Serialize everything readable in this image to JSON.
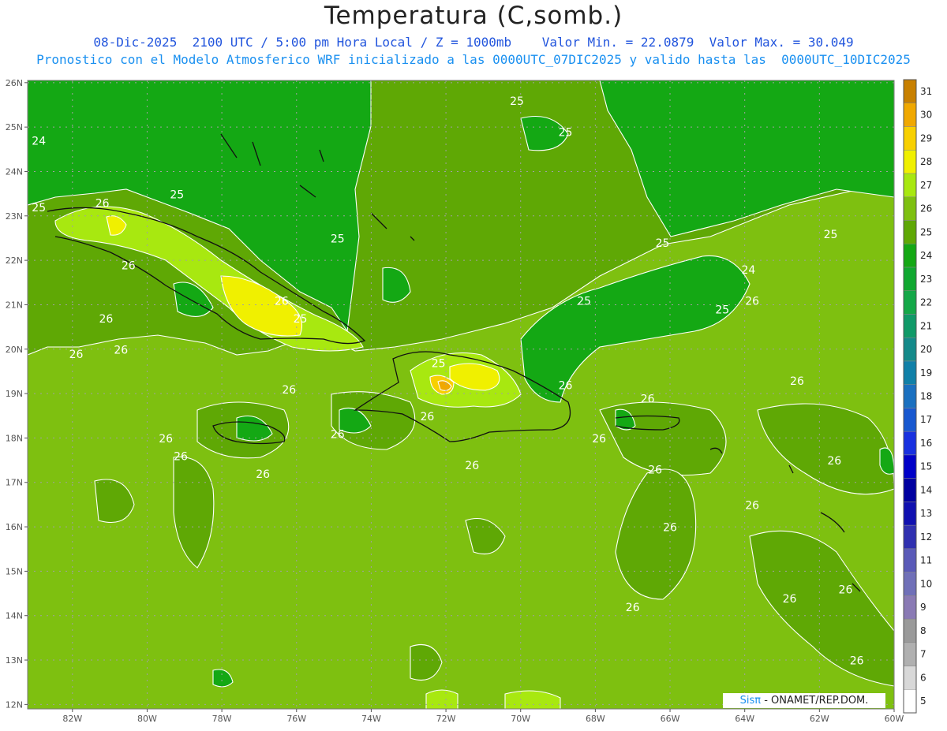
{
  "title": "Temperatura (C,somb.)",
  "subtitle_line1": "08-Dic-2025  2100 UTC / 5:00 pm Hora Local / Z = 1000mb    Valor Min. = 22.0879  Valor Max. = 30.049",
  "subtitle_line2": "Pronostico con el Modelo Atmosferico WRF inicializado a las 0000UTC_07DIC2025 y valido hasta las  0000UTC_10DIC2025",
  "credit": {
    "brand": "Sisπ",
    "text": " - ONAMET/REP.DOM."
  },
  "lat_ticks": [
    "26N",
    "25N",
    "24N",
    "23N",
    "22N",
    "21N",
    "20N",
    "19N",
    "18N",
    "17N",
    "16N",
    "15N",
    "14N",
    "13N",
    "12N"
  ],
  "lon_ticks": [
    "82W",
    "80W",
    "78W",
    "76W",
    "74W",
    "72W",
    "70W",
    "68W",
    "66W",
    "64W",
    "62W",
    "60W"
  ],
  "contour_labels": [
    {
      "text": "24",
      "lon": -82.9,
      "lat": 24.6
    },
    {
      "text": "25",
      "lon": -82.9,
      "lat": 23.1
    },
    {
      "text": "26",
      "lon": -81.2,
      "lat": 23.2
    },
    {
      "text": "25",
      "lon": -79.2,
      "lat": 23.4
    },
    {
      "text": "26",
      "lon": -80.5,
      "lat": 21.8
    },
    {
      "text": "26",
      "lon": -81.1,
      "lat": 20.6
    },
    {
      "text": "26",
      "lon": -81.9,
      "lat": 19.8
    },
    {
      "text": "26",
      "lon": -80.7,
      "lat": 19.9
    },
    {
      "text": "26",
      "lon": -76.4,
      "lat": 21.0
    },
    {
      "text": "25",
      "lon": -75.9,
      "lat": 20.6
    },
    {
      "text": "25",
      "lon": -74.9,
      "lat": 22.4
    },
    {
      "text": "26",
      "lon": -76.2,
      "lat": 19.0
    },
    {
      "text": "26",
      "lon": -79.5,
      "lat": 17.9
    },
    {
      "text": "26",
      "lon": -79.1,
      "lat": 17.5
    },
    {
      "text": "26",
      "lon": -76.9,
      "lat": 17.1
    },
    {
      "text": "26",
      "lon": -74.9,
      "lat": 18.0
    },
    {
      "text": "26",
      "lon": -72.5,
      "lat": 18.4
    },
    {
      "text": "25",
      "lon": -72.2,
      "lat": 19.6
    },
    {
      "text": "26",
      "lon": -71.3,
      "lat": 17.3
    },
    {
      "text": "25",
      "lon": -70.1,
      "lat": 25.5
    },
    {
      "text": "25",
      "lon": -68.8,
      "lat": 24.8
    },
    {
      "text": "26",
      "lon": -68.8,
      "lat": 19.1
    },
    {
      "text": "25",
      "lon": -68.3,
      "lat": 21.0
    },
    {
      "text": "26",
      "lon": -67.9,
      "lat": 17.9
    },
    {
      "text": "26",
      "lon": -66.4,
      "lat": 17.2
    },
    {
      "text": "25",
      "lon": -66.2,
      "lat": 22.3
    },
    {
      "text": "26",
      "lon": -66.6,
      "lat": 18.8
    },
    {
      "text": "24",
      "lon": -63.9,
      "lat": 21.7
    },
    {
      "text": "26",
      "lon": -63.8,
      "lat": 21.0
    },
    {
      "text": "25",
      "lon": -64.6,
      "lat": 20.8
    },
    {
      "text": "26",
      "lon": -62.6,
      "lat": 19.2
    },
    {
      "text": "25",
      "lon": -61.7,
      "lat": 22.5
    },
    {
      "text": "26",
      "lon": -61.6,
      "lat": 17.4
    },
    {
      "text": "26",
      "lon": -63.8,
      "lat": 16.4
    },
    {
      "text": "26",
      "lon": -66.0,
      "lat": 15.9
    },
    {
      "text": "26",
      "lon": -67.0,
      "lat": 14.1
    },
    {
      "text": "26",
      "lon": -62.8,
      "lat": 14.3
    },
    {
      "text": "26",
      "lon": -61.3,
      "lat": 14.5
    },
    {
      "text": "26",
      "lon": -61.0,
      "lat": 12.9
    }
  ],
  "colorbar": {
    "levels": [
      "5",
      "6",
      "7",
      "8",
      "9",
      "10",
      "11",
      "12",
      "13",
      "14",
      "15",
      "16",
      "17",
      "18",
      "19",
      "20",
      "21",
      "22",
      "23",
      "24",
      "25",
      "26",
      "27",
      "28",
      "29",
      "30",
      "31"
    ],
    "colors": [
      "#ffffff",
      "#d8d8d8",
      "#b0b0b0",
      "#9a9a9a",
      "#8a7ab4",
      "#7070b8",
      "#5a5ab8",
      "#3030b0",
      "#1010b0",
      "#0000a0",
      "#0000c8",
      "#1830e0",
      "#1858d0",
      "#1a70c0",
      "#1080a8",
      "#148a8a",
      "#109a68",
      "#14a848",
      "#10a830",
      "#14a814",
      "#5fa805",
      "#7ec010",
      "#a8e810",
      "#f0f000",
      "#f8d000",
      "#f0a800",
      "#c88000"
    ]
  },
  "field_colors": {
    "t24": "#14a814",
    "t25": "#5fa805",
    "t26": "#7ec010",
    "t27": "#a8e810",
    "t28": "#f0f000",
    "t29": "#f8d000",
    "t30": "#f0a800"
  }
}
